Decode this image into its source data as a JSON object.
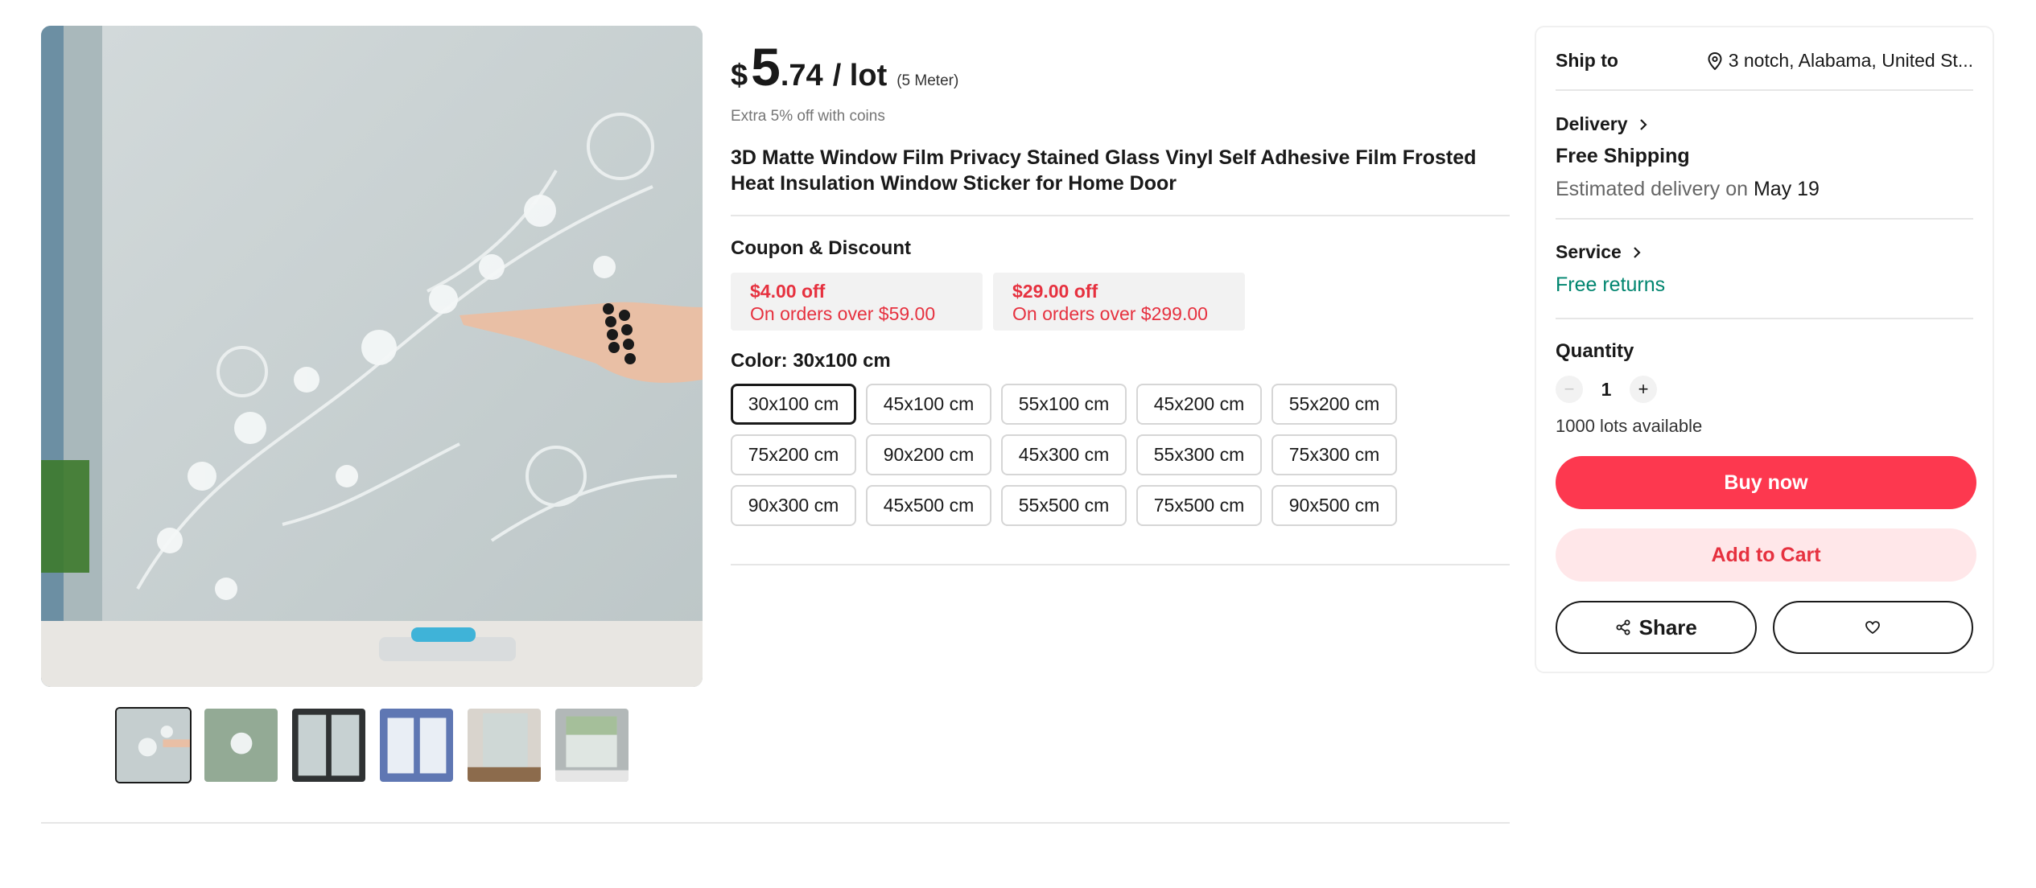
{
  "product": {
    "price_currency": "$",
    "price_int": "5",
    "price_dec": ".74",
    "price_unit": "/ lot",
    "price_pack": "(5 Meter)",
    "coin_note": "Extra 5% off with coins",
    "title": "3D Matte Window Film Privacy Stained Glass Vinyl Self Adhesive Film Frosted Heat Insulation Window Sticker for Home Door"
  },
  "coupons": {
    "label": "Coupon & Discount",
    "items": [
      {
        "amount": "$4.00 off",
        "condition": "On orders over $59.00"
      },
      {
        "amount": "$29.00 off",
        "condition": "On orders over $299.00"
      }
    ]
  },
  "color": {
    "label": "Color: 30x100 cm",
    "selected": "30x100 cm",
    "options": [
      "30x100 cm",
      "45x100 cm",
      "55x100 cm",
      "45x200 cm",
      "55x200 cm",
      "75x200 cm",
      "90x200 cm",
      "45x300 cm",
      "55x300 cm",
      "75x300 cm",
      "90x300 cm",
      "45x500 cm",
      "55x500 cm",
      "75x500 cm",
      "90x500 cm"
    ]
  },
  "panel": {
    "ship_label": "Ship to",
    "ship_location": "3 notch, Alabama, United St...",
    "delivery_label": "Delivery",
    "free_shipping": "Free Shipping",
    "est_prefix": "Estimated delivery on",
    "est_date": "May 19",
    "service_label": "Service",
    "free_returns": "Free returns",
    "quantity_label": "Quantity",
    "quantity_minus": "−",
    "quantity_value": "1",
    "quantity_plus": "+",
    "available": "1000 lots available",
    "buy_now": "Buy now",
    "add_to_cart": "Add to Cart",
    "share": "Share"
  },
  "icons": {
    "pin": "location-pin-icon",
    "chevron": "chevron-right-icon",
    "share": "share-icon",
    "heart": "heart-icon"
  },
  "colors": {
    "accent": "#fd384f",
    "coupon_text": "#e6313f",
    "free_returns": "#00856f"
  }
}
